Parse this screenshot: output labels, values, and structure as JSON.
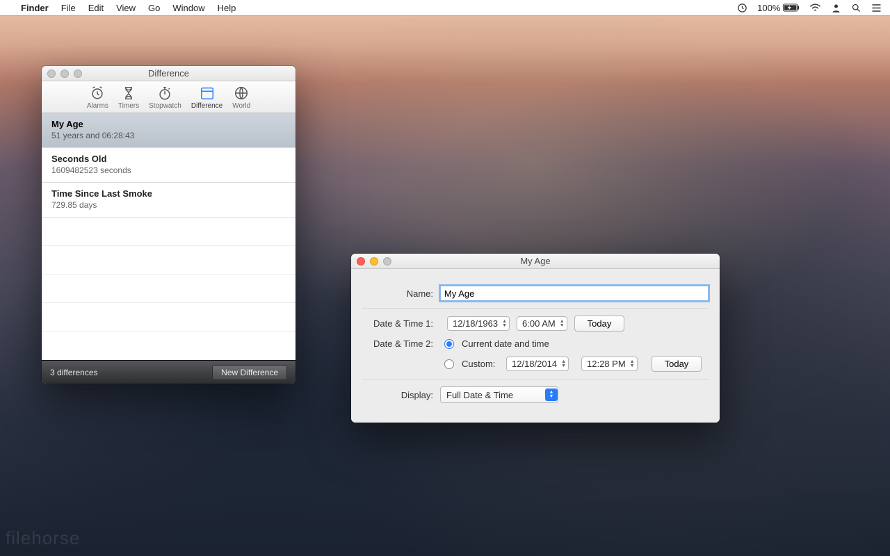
{
  "menubar": {
    "app": "Finder",
    "items": [
      "File",
      "Edit",
      "View",
      "Go",
      "Window",
      "Help"
    ],
    "battery": "100%"
  },
  "diffWindow": {
    "title": "Difference",
    "toolbar": [
      {
        "label": "Alarms",
        "icon": "alarm"
      },
      {
        "label": "Timers",
        "icon": "hourglass"
      },
      {
        "label": "Stopwatch",
        "icon": "stopwatch"
      },
      {
        "label": "Difference",
        "icon": "calendar",
        "active": true
      },
      {
        "label": "World",
        "icon": "globe"
      }
    ],
    "rows": [
      {
        "title": "My Age",
        "subtitle": "51 years and 06:28:43",
        "selected": true
      },
      {
        "title": "Seconds Old",
        "subtitle": "1609482523 seconds"
      },
      {
        "title": "Time Since Last Smoke",
        "subtitle": "729.85 days"
      }
    ],
    "footer": {
      "status": "3 differences",
      "button": "New Difference"
    }
  },
  "detailWindow": {
    "title": "My Age",
    "nameLabel": "Name:",
    "nameValue": "My Age",
    "dt1Label": "Date & Time 1:",
    "dt1Date": "12/18/1963",
    "dt1Time": "6:00 AM",
    "todayBtn": "Today",
    "dt2Label": "Date & Time 2:",
    "dt2OptCurrent": "Current date and time",
    "dt2OptCustom": "Custom:",
    "dt2Date": "12/18/2014",
    "dt2Time": "12:28 PM",
    "displayLabel": "Display:",
    "displayValue": "Full Date & Time"
  },
  "watermark": "filehorse"
}
